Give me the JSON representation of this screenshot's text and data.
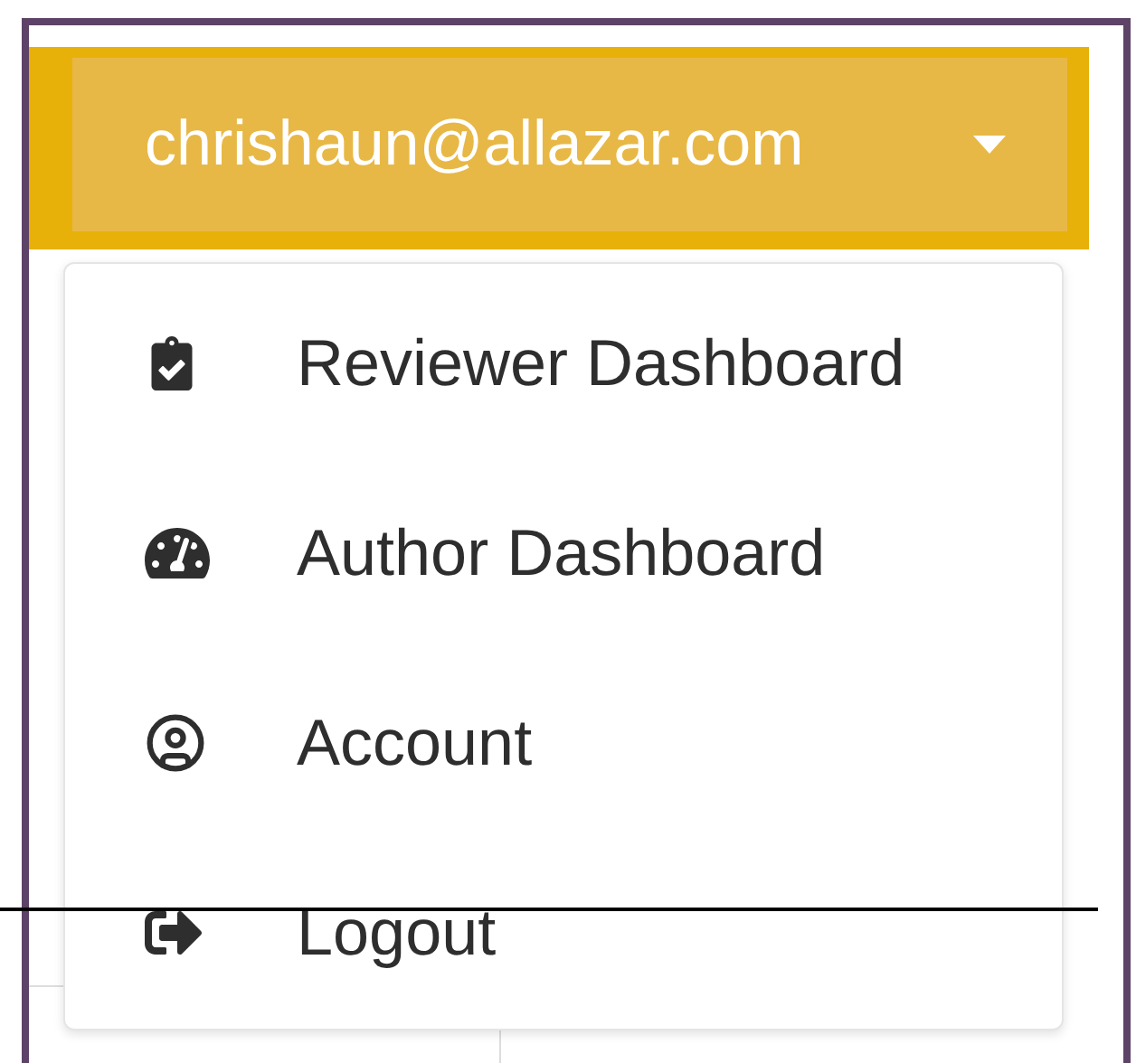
{
  "user_menu": {
    "email": "chrishaun@allazar.com",
    "expanded": true,
    "items": [
      {
        "label": "Reviewer Dashboard"
      },
      {
        "label": "Author Dashboard"
      },
      {
        "label": "Account"
      },
      {
        "label": "Logout"
      }
    ]
  }
}
